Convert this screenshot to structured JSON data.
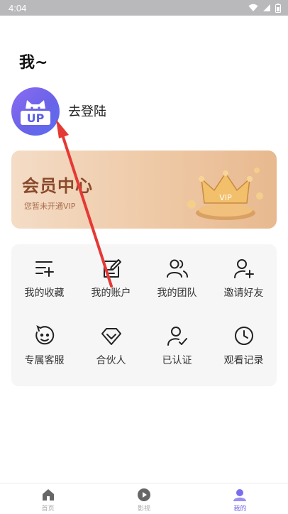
{
  "status_bar": {
    "time": "4:04"
  },
  "page": {
    "title": "我~"
  },
  "profile": {
    "avatar_text": "UP",
    "login_label": "去登陆"
  },
  "vip": {
    "title": "会员中心",
    "subtitle": "您暂未开通VIP",
    "badge": "VIP"
  },
  "menu": {
    "items": [
      {
        "label": "我的收藏",
        "icon": "list-add-icon"
      },
      {
        "label": "我的账户",
        "icon": "edit-note-icon"
      },
      {
        "label": "我的团队",
        "icon": "team-icon"
      },
      {
        "label": "邀请好友",
        "icon": "add-user-icon"
      },
      {
        "label": "专属客服",
        "icon": "service-icon"
      },
      {
        "label": "合伙人",
        "icon": "partner-icon"
      },
      {
        "label": "已认证",
        "icon": "verified-user-icon"
      },
      {
        "label": "观看记录",
        "icon": "clock-icon"
      }
    ]
  },
  "tabs": [
    {
      "label": "首页",
      "icon": "home-icon"
    },
    {
      "label": "影视",
      "icon": "play-icon"
    },
    {
      "label": "我的",
      "icon": "user-icon"
    }
  ],
  "colors": {
    "accent": "#6b63e8",
    "vip_text": "#8a4a2c",
    "annotation_arrow": "#e53935"
  }
}
